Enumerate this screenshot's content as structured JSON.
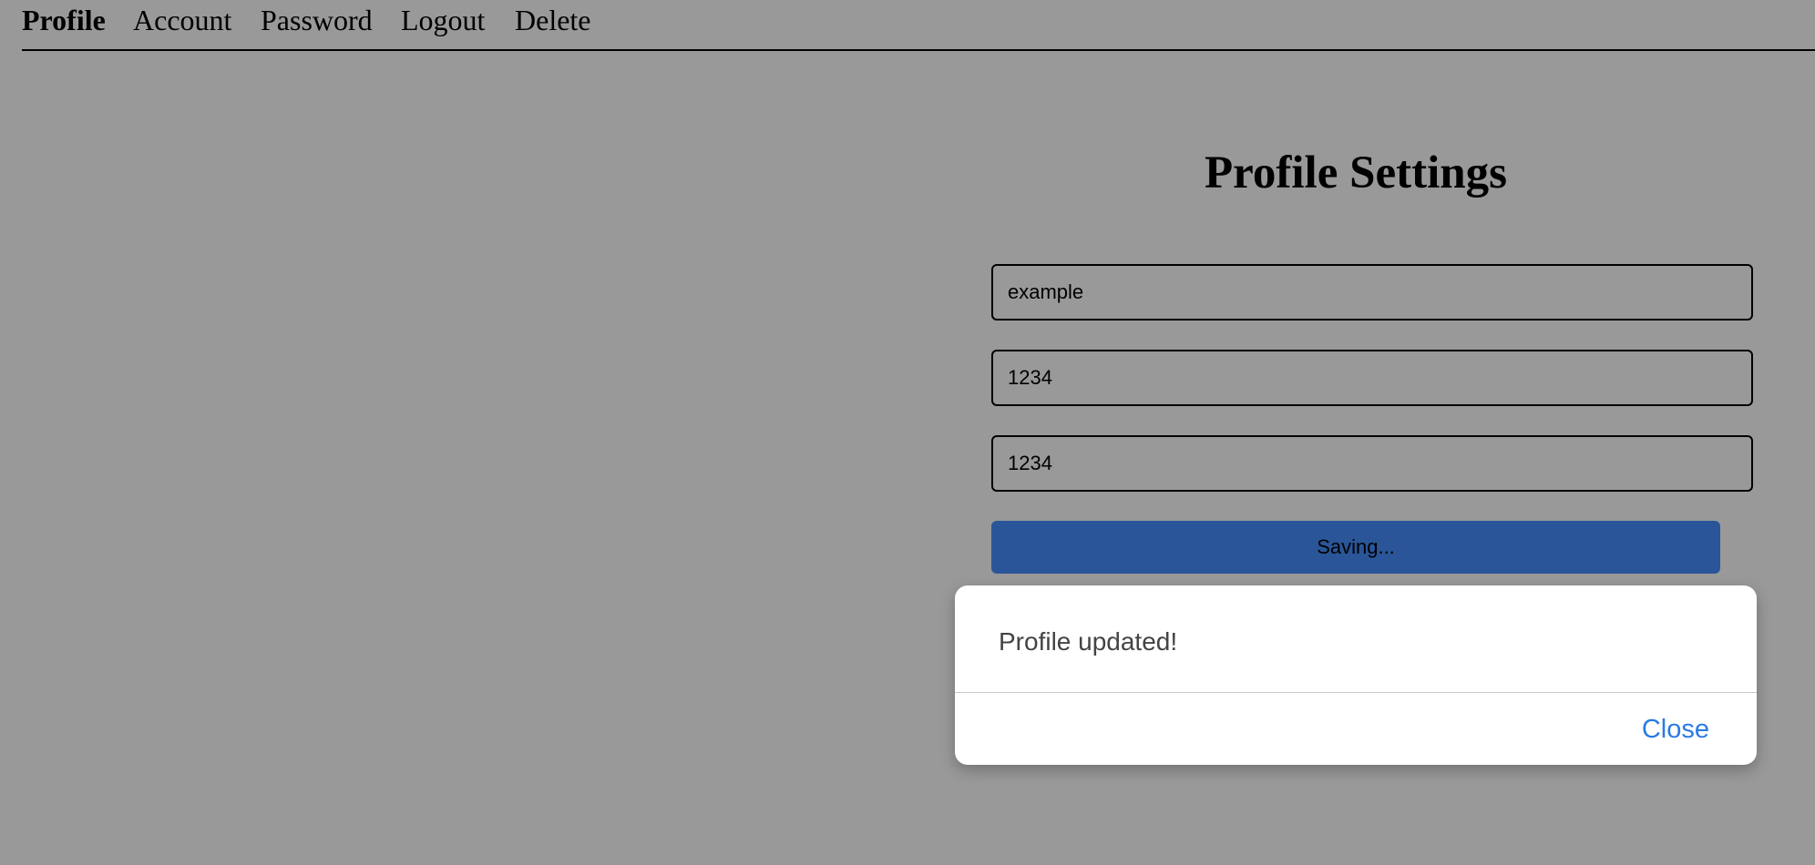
{
  "nav": {
    "items": [
      {
        "label": "Profile",
        "active": true
      },
      {
        "label": "Account",
        "active": false
      },
      {
        "label": "Password",
        "active": false
      },
      {
        "label": "Logout",
        "active": false
      },
      {
        "label": "Delete",
        "active": false
      }
    ]
  },
  "main": {
    "title": "Profile Settings",
    "fields": [
      {
        "value": "example"
      },
      {
        "value": "1234"
      },
      {
        "value": "1234"
      }
    ],
    "save_button_label": "Saving..."
  },
  "dialog": {
    "message": "Profile updated!",
    "close_label": "Close"
  },
  "colors": {
    "background": "#999999",
    "primary_button": "#2a5699",
    "link_blue": "#2a7ae4"
  }
}
